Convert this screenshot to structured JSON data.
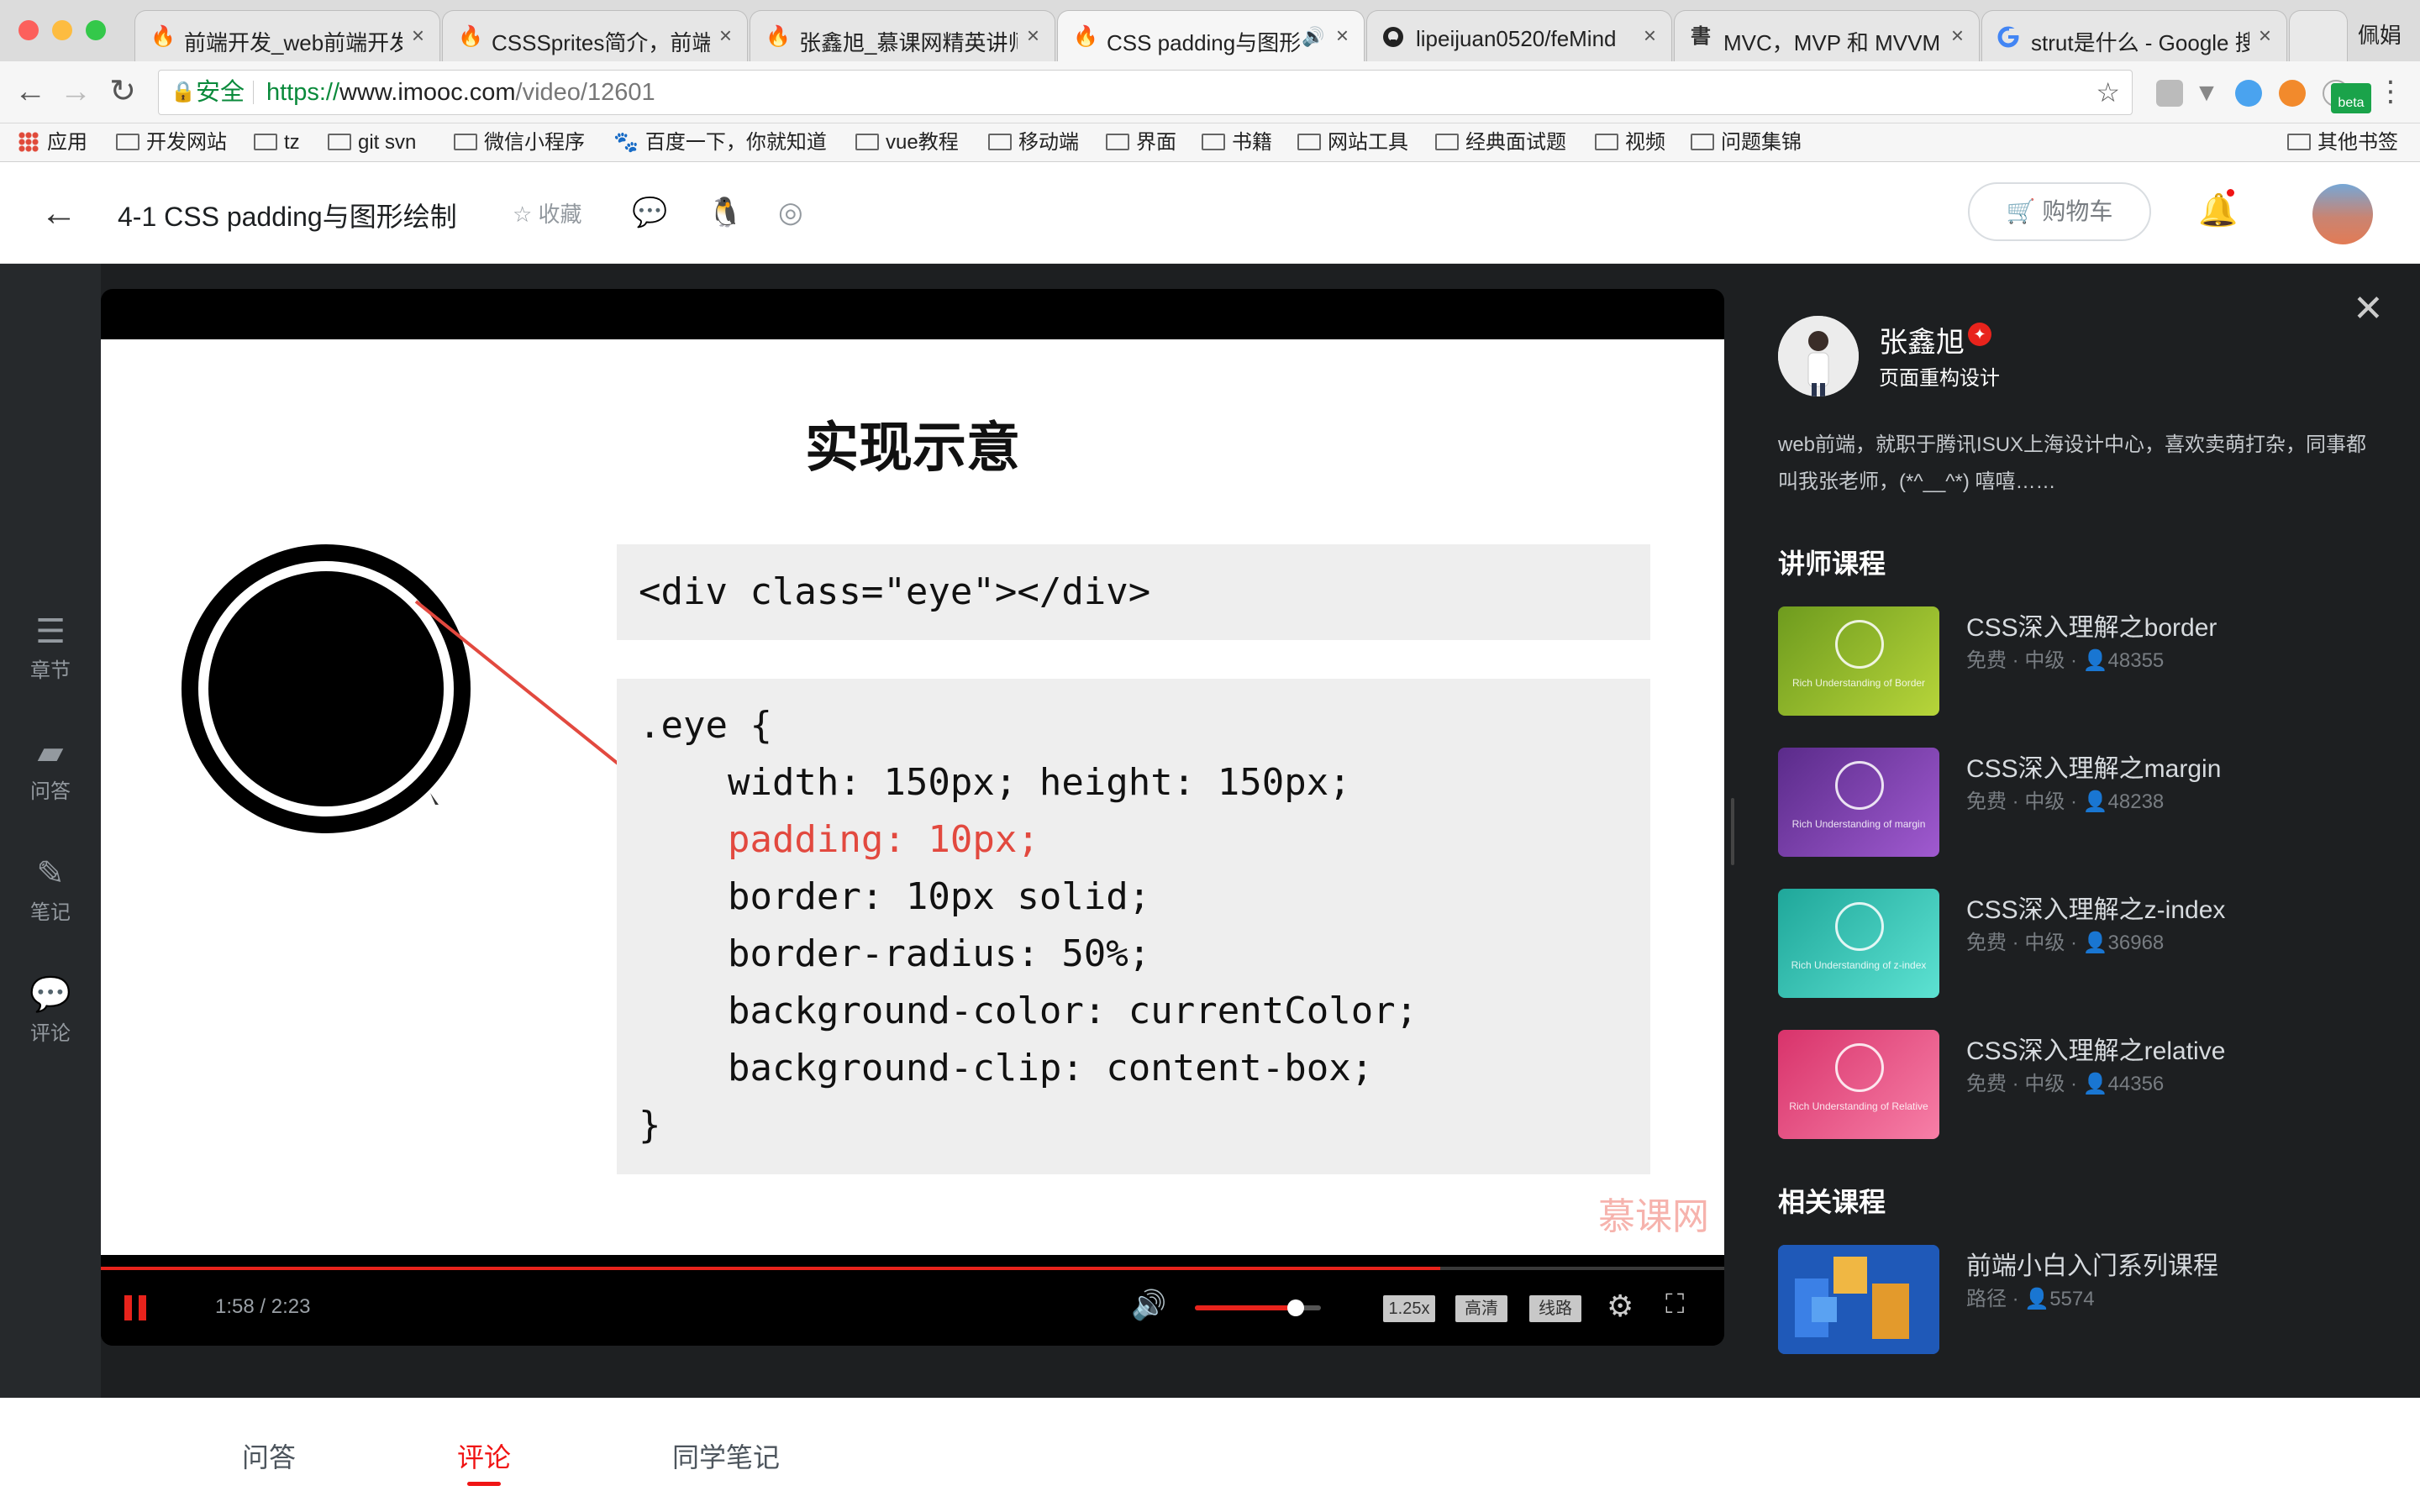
{
  "browser": {
    "tabs": [
      {
        "title": "前端开发_web前端开发",
        "icon": "imooc-flame-icon"
      },
      {
        "title": "CSSSprites简介，前端",
        "icon": "imooc-flame-icon"
      },
      {
        "title": "张鑫旭_慕课网精英讲师",
        "icon": "imooc-flame-icon"
      },
      {
        "title": "CSS padding与图形",
        "icon": "imooc-flame-icon",
        "audio": "🔊"
      },
      {
        "title": "lipeijuan0520/feMind",
        "icon": "github-icon"
      },
      {
        "title": "MVC，MVP 和 MVVM",
        "icon": "blog-icon"
      },
      {
        "title": "strut是什么 - Google 搜",
        "icon": "google-icon"
      }
    ],
    "close_glyph": "×",
    "profile_name": "佩娟",
    "secure_label": "安全",
    "url_scheme": "https://",
    "url_host": "www.imooc.com",
    "url_path": "/video/12601",
    "ext_beta_label": "beta",
    "bookmarks": [
      "应用",
      "开发网站",
      "tz",
      "git svn",
      "微信小程序",
      "百度一下，你就知道",
      "vue教程",
      "移动端",
      "界面",
      "书籍",
      "网站工具",
      "经典面试题",
      "视频",
      "问题集锦"
    ],
    "other_bookmarks": "其他书签"
  },
  "header": {
    "title": "4-1 CSS padding与图形绘制",
    "favorite_label": "收藏",
    "cart_label": "购物车"
  },
  "rail": [
    {
      "label": "章节",
      "icon": "chapters-icon"
    },
    {
      "label": "问答",
      "icon": "qa-icon"
    },
    {
      "label": "笔记",
      "icon": "notes-icon"
    },
    {
      "label": "评论",
      "icon": "comments-icon"
    }
  ],
  "slide": {
    "title": "实现示意",
    "code_html": "<div class=\"eye\"></div>",
    "code_lines": [
      ".eye {",
      "    width: 150px; height: 150px;",
      "    padding: 10px;",
      "    border: 10px solid;",
      "    border-radius: 50%;",
      "    background-color: currentColor;",
      "    background-clip: content-box;",
      "}"
    ],
    "highlight_line": 2,
    "highlight_color": "#e2493f",
    "watermark": "慕课网"
  },
  "player": {
    "time": "1:58 / 2:23",
    "progress": 0.825,
    "volume": 0.8,
    "speed_label": "1.25x",
    "quality_label": "高清",
    "line_label": "线路",
    "accent_color": "#e8231c"
  },
  "teacher": {
    "name": "张鑫旭",
    "job": "页面重构设计",
    "desc": "web前端，就职于腾讯ISUX上海设计中心，喜欢卖萌打杂，同事都叫我张老师，(*^__^*) 嘻嘻……"
  },
  "teacher_courses_heading": "讲师课程",
  "teacher_courses": [
    {
      "title": "CSS深入理解之border",
      "meta": "免费 · 中级 · 👤48355",
      "caption": "Rich Understanding of Border",
      "gradient": "#6e9b1e,#b7d53a"
    },
    {
      "title": "CSS深入理解之margin",
      "meta": "免费 · 中级 · 👤48238",
      "caption": "Rich Understanding of margin",
      "gradient": "#5a2b8a,#a05ad0"
    },
    {
      "title": "CSS深入理解之z-index",
      "meta": "免费 · 中级 · 👤36968",
      "caption": "Rich Understanding of z-index",
      "gradient": "#1fa79a,#5de2d2"
    },
    {
      "title": "CSS深入理解之relative",
      "meta": "免费 · 中级 · 👤44356",
      "caption": "Rich Understanding of Relative",
      "gradient": "#d8336b,#f77fa7"
    }
  ],
  "related_heading": "相关课程",
  "related_courses": [
    {
      "title": "前端小白入门系列课程",
      "meta": "路径 · 👤5574"
    }
  ],
  "bottom_tabs": [
    "问答",
    "评论",
    "同学笔记"
  ],
  "active_bottom_tab": 1
}
